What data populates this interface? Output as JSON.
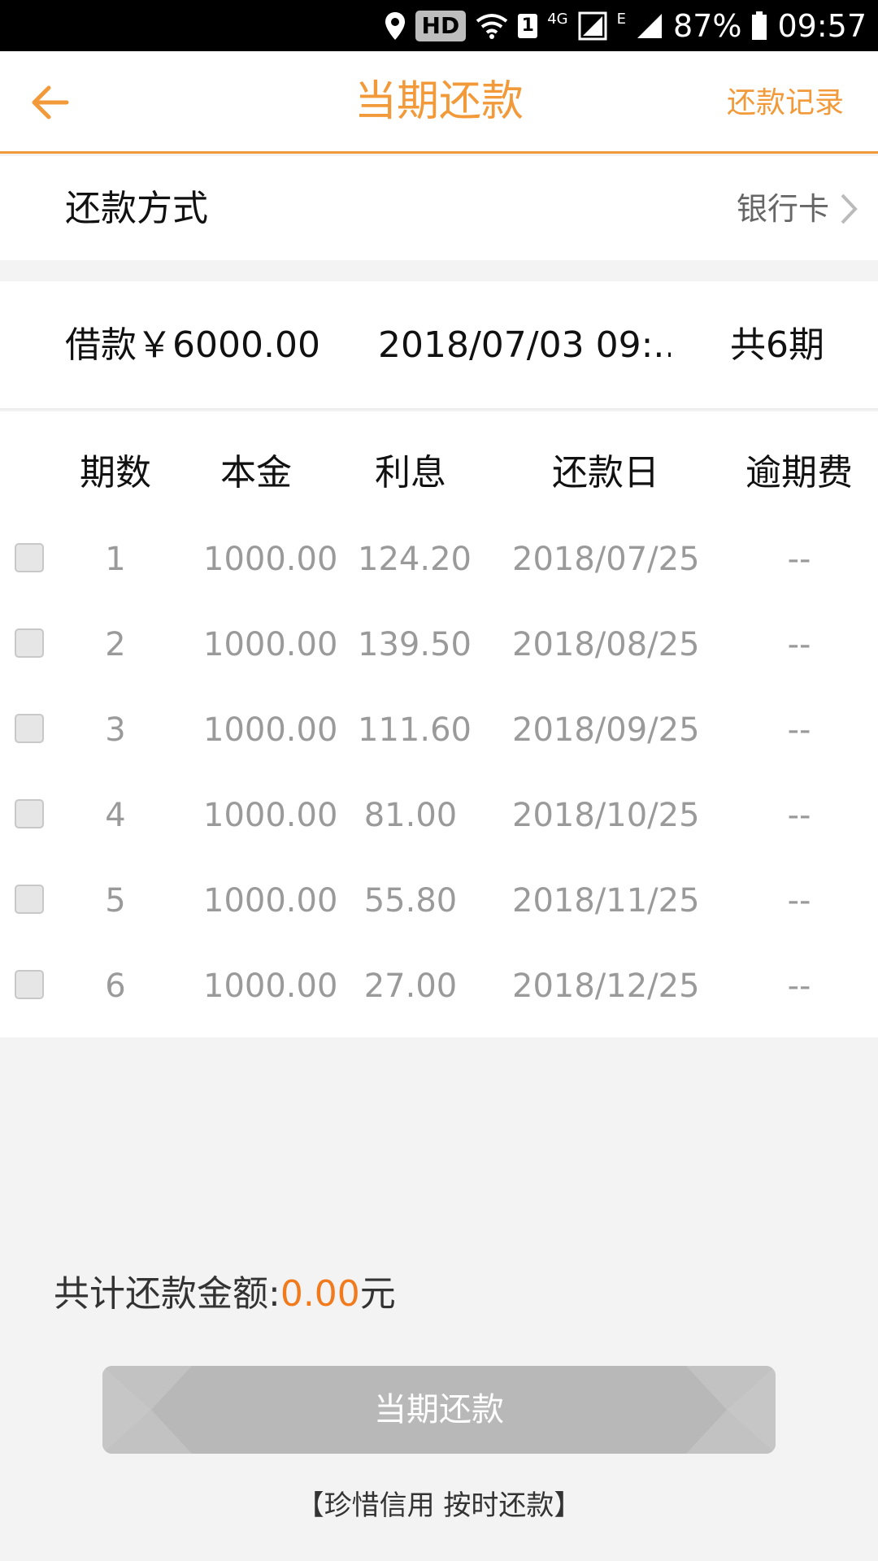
{
  "status_bar": {
    "hd": "HD",
    "sim": "1",
    "network_4g": "4G",
    "network_e": "E",
    "battery": "87%",
    "time": "09:57"
  },
  "nav": {
    "title": "当期还款",
    "records_label": "还款记录"
  },
  "payment_method": {
    "label": "还款方式",
    "value": "银行卡"
  },
  "loan": {
    "amount": "借款￥6000.00",
    "date": "2018/07/03 09:...",
    "periods": "共6期"
  },
  "table": {
    "headers": {
      "period": "期数",
      "principal": "本金",
      "interest": "利息",
      "due_date": "还款日",
      "late_fee": "逾期费"
    },
    "rows": [
      {
        "period": "1",
        "principal": "1000.00",
        "interest": "124.20",
        "due_date": "2018/07/25",
        "late_fee": "--"
      },
      {
        "period": "2",
        "principal": "1000.00",
        "interest": "139.50",
        "due_date": "2018/08/25",
        "late_fee": "--"
      },
      {
        "period": "3",
        "principal": "1000.00",
        "interest": "111.60",
        "due_date": "2018/09/25",
        "late_fee": "--"
      },
      {
        "period": "4",
        "principal": "1000.00",
        "interest": "81.00",
        "due_date": "2018/10/25",
        "late_fee": "--"
      },
      {
        "period": "5",
        "principal": "1000.00",
        "interest": "55.80",
        "due_date": "2018/11/25",
        "late_fee": "--"
      },
      {
        "period": "6",
        "principal": "1000.00",
        "interest": "27.00",
        "due_date": "2018/12/25",
        "late_fee": "--"
      }
    ]
  },
  "total": {
    "label": "共计还款金额:",
    "amount": "0.00",
    "unit": "元"
  },
  "pay_button": {
    "label": "当期还款"
  },
  "slogan": "【珍惜信用  按时还款】",
  "colors": {
    "accent": "#f29a3a",
    "amount": "#f07a1c",
    "button_disabled": "#b8b8b8"
  }
}
